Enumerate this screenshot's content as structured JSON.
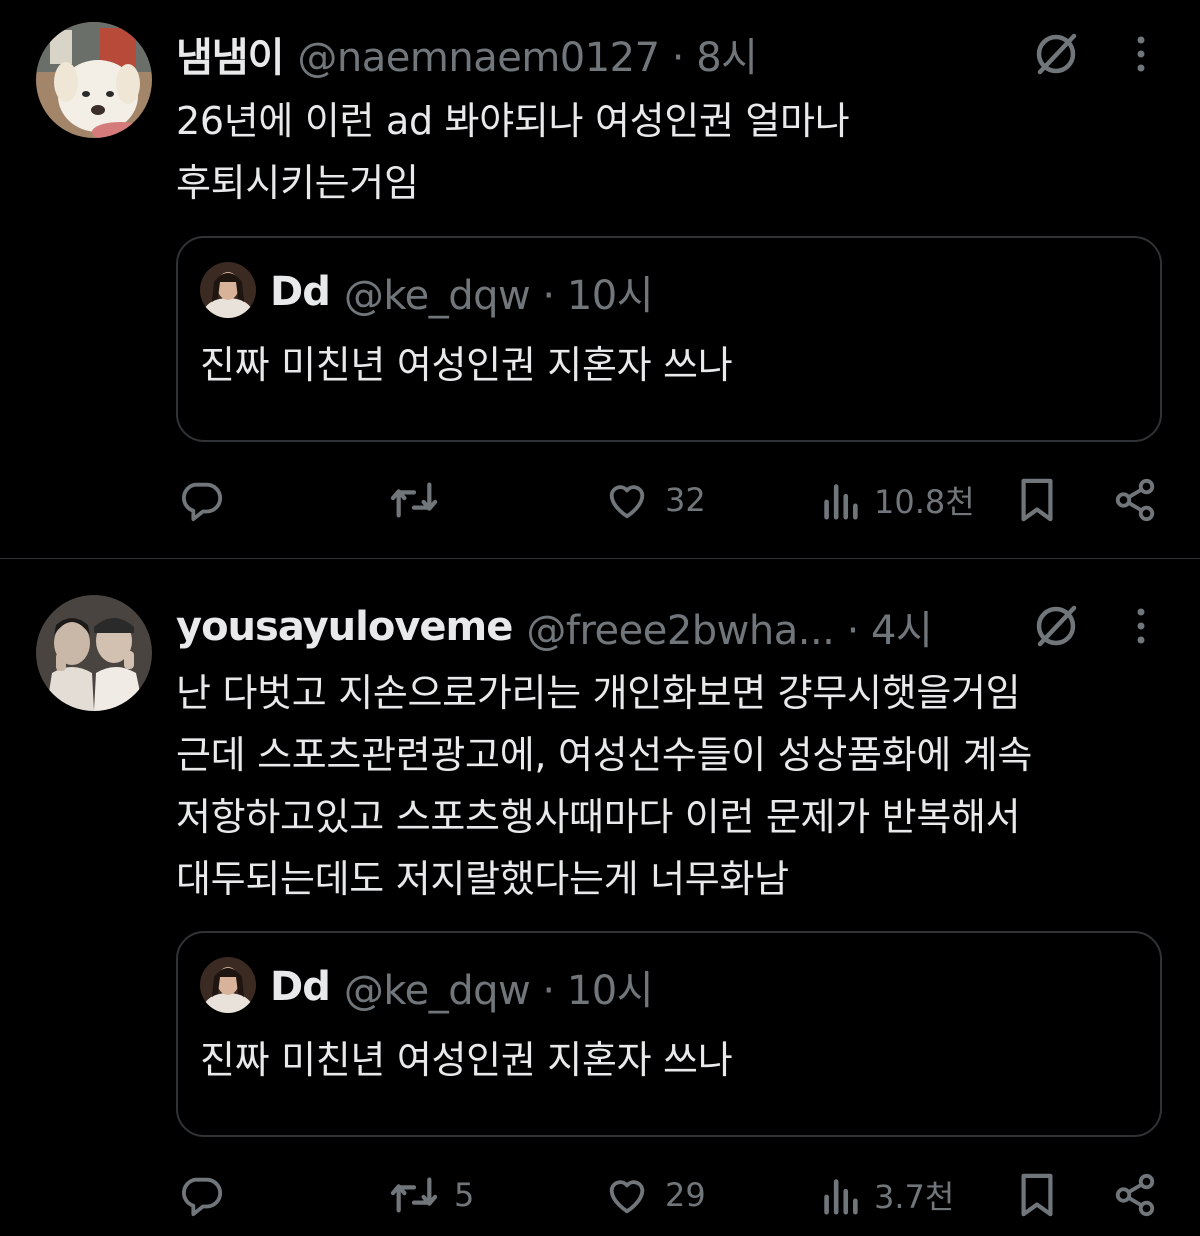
{
  "colors": {
    "background": "#000000",
    "text": "#e7e9ea",
    "muted": "#71767b",
    "border": "#2f3336"
  },
  "tweets": [
    {
      "name": "냄냄이",
      "handle": "@naemnaem0127 · 8시",
      "body": [
        "26년에 이런 ad 봐야되나 여성인권 얼마나",
        "후퇴시키는거임"
      ],
      "avatar_icon": "puppy-avatar",
      "quote": {
        "name": "Dd",
        "handle": "@ke_dqw · 10시",
        "text": "진짜 미친년 여성인권 지혼자 쓰나"
      },
      "actions": {
        "reply": "",
        "retweet": "",
        "like": "32",
        "views": "10.8천"
      }
    },
    {
      "name": "yousayuloveme",
      "handle": "@freee2bwha... · 4시",
      "body": [
        "난 다벗고 지손으로가리는 개인화보면 걍무시햇을거임",
        "근데 스포츠관련광고에, 여성선수들이 성상품화에 계속",
        "저항하고있고 스포츠행사때마다 이런 문제가 반복해서",
        "대두되는데도 저지랄했다는게 너무화남"
      ],
      "avatar_icon": "two-people-avatar",
      "quote": {
        "name": "Dd",
        "handle": "@ke_dqw · 10시",
        "text": "진짜 미친년 여성인권 지혼자 쓰나"
      },
      "actions": {
        "reply": "",
        "retweet": "5",
        "like": "29",
        "views": "3.7천"
      }
    }
  ]
}
